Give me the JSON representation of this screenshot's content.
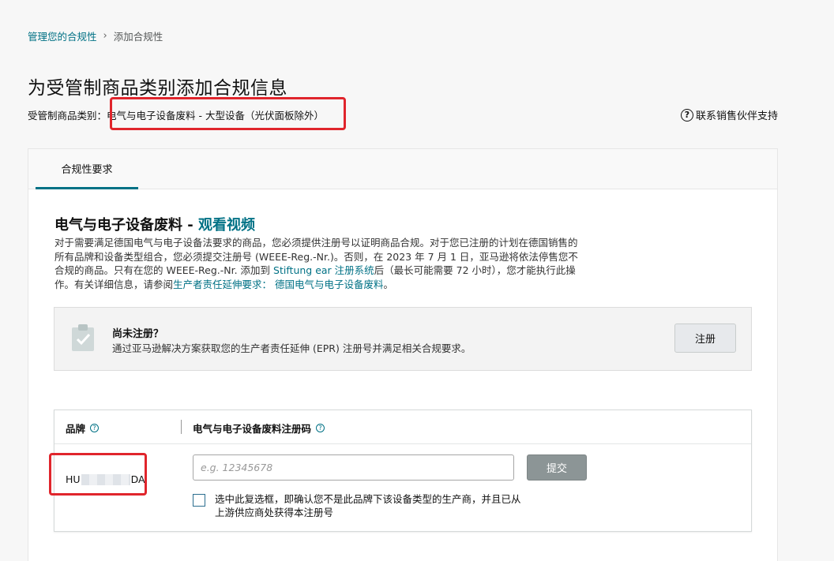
{
  "breadcrumb": {
    "parent": "管理您的合规性",
    "separator": "›",
    "current": "添加合规性"
  },
  "page_title": "为受管制商品类别添加合规信息",
  "category": {
    "label": "受管制商品类别：",
    "value": "电气与电子设备废料 - 大型设备（光伏面板除外）"
  },
  "support": {
    "icon": "?",
    "label": "联系销售伙伴支持"
  },
  "tabs": [
    {
      "label": "合规性要求",
      "active": true
    }
  ],
  "section": {
    "title": "电气与电子设备废料 - ",
    "video_link": "观看视频",
    "desc_part1": "对于需要满足德国电气与电子设备法要求的商品，您必须提供注册号以证明商品合规。对于您已注册的计划在德国销售的所有品牌和设备类型组合，您必须提交注册号 (WEEE-Reg.-Nr.)。否则，在 2023 年 7 月 1 日，亚马逊将依法停售您不合规的商品。只有在您的 WEEE-Reg.-Nr. 添加到 ",
    "desc_link1": "Stiftung ear 注册系统",
    "desc_part2": "后（最长可能需要 72 小时），您才能执行此操作。有关详细信息，请参阅",
    "desc_link2": "生产者责任延伸要求： 德国电气与电子设备废料",
    "desc_part3": "。"
  },
  "register": {
    "title": "尚未注册？",
    "description": "通过亚马逊解决方案获取您的生产者责任延伸 (EPR) 注册号并满足相关合规要求。",
    "button": "注册"
  },
  "table": {
    "col_brand": "品牌",
    "col_code": "电气与电子设备废料注册码",
    "info_icon": "?",
    "row": {
      "brand_prefix": "HU",
      "brand_suffix": "DA",
      "input_placeholder": "e.g. 12345678",
      "input_value": "",
      "submit": "提交",
      "checkbox_checked": false,
      "checkbox_label": "选中此复选框，即确认您不是此品牌下该设备类型的生产商，并且已从上游供应商处获得本注册号"
    }
  },
  "colors": {
    "link": "#007185",
    "highlight": "#e0252c",
    "submit_bg": "#8c9596"
  }
}
